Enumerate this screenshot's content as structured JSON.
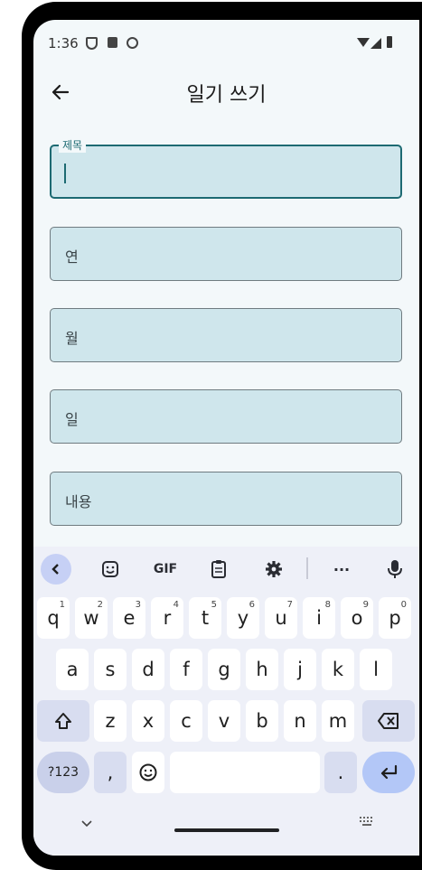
{
  "status": {
    "time": "1:36"
  },
  "app": {
    "title": "일기 쓰기"
  },
  "form": {
    "title_label": "제목",
    "title_value": "",
    "year_placeholder": "연",
    "month_placeholder": "월",
    "day_placeholder": "일",
    "content_placeholder": "내용"
  },
  "keyboard": {
    "toolbar": {
      "gif": "GIF",
      "more": "···"
    },
    "row1": [
      {
        "k": "q",
        "n": "1"
      },
      {
        "k": "w",
        "n": "2"
      },
      {
        "k": "e",
        "n": "3"
      },
      {
        "k": "r",
        "n": "4"
      },
      {
        "k": "t",
        "n": "5"
      },
      {
        "k": "y",
        "n": "6"
      },
      {
        "k": "u",
        "n": "7"
      },
      {
        "k": "i",
        "n": "8"
      },
      {
        "k": "o",
        "n": "9"
      },
      {
        "k": "p",
        "n": "0"
      }
    ],
    "row2": [
      "a",
      "s",
      "d",
      "f",
      "g",
      "h",
      "j",
      "k",
      "l"
    ],
    "row3": [
      "z",
      "x",
      "c",
      "v",
      "b",
      "n",
      "m"
    ],
    "sym_label": "?123",
    "comma": ",",
    "period": "."
  }
}
